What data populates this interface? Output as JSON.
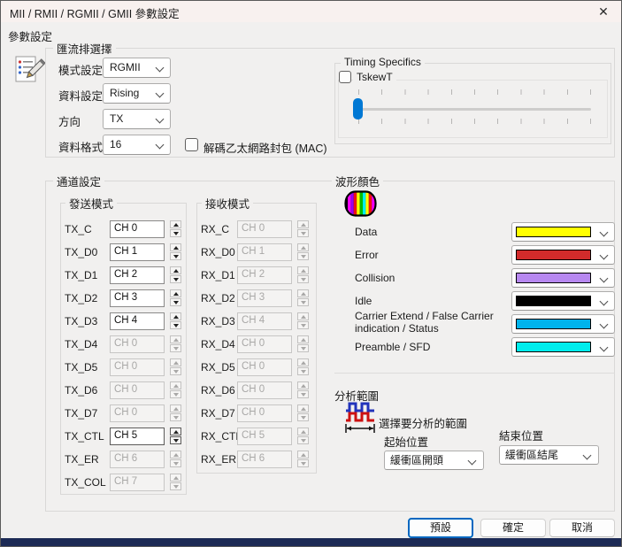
{
  "window": {
    "title": "MII / RMII / RGMII / GMII 參數設定",
    "close_glyph": "✕",
    "tab_label": "參數設定"
  },
  "theme": {
    "accent": "#0078D4",
    "default_button_border": "#0067C0",
    "bottom_strip": "#1C2A55"
  },
  "bus": {
    "group_label": "匯流排選擇",
    "mode": {
      "label": "模式設定",
      "value": "RGMII"
    },
    "data_edge": {
      "label": "資料設定",
      "value": "Rising"
    },
    "direction": {
      "label": "方向",
      "value": "TX"
    },
    "data_format": {
      "label": "資料格式",
      "value": "16"
    },
    "mac_checkbox_label": "解碼乙太網路封包 (MAC)",
    "mac_checked": false
  },
  "timing": {
    "group_label": "Timing Specifics",
    "tskew_label": "TskewT",
    "tskew_checked": false,
    "slider_ticks": 11,
    "slider_position": "min"
  },
  "channels": {
    "group_label": "通道設定",
    "tx": {
      "group_label": "發送模式",
      "rows": [
        {
          "label": "TX_C",
          "value": "CH 0",
          "enabled": true
        },
        {
          "label": "TX_D0",
          "value": "CH 1",
          "enabled": true
        },
        {
          "label": "TX_D1",
          "value": "CH 2",
          "enabled": true
        },
        {
          "label": "TX_D2",
          "value": "CH 3",
          "enabled": true
        },
        {
          "label": "TX_D3",
          "value": "CH 4",
          "enabled": true
        },
        {
          "label": "TX_D4",
          "value": "CH 0",
          "enabled": false
        },
        {
          "label": "TX_D5",
          "value": "CH 0",
          "enabled": false
        },
        {
          "label": "TX_D6",
          "value": "CH 0",
          "enabled": false
        },
        {
          "label": "TX_D7",
          "value": "CH 0",
          "enabled": false
        },
        {
          "label": "TX_CTL",
          "value": "CH 5",
          "enabled": true
        },
        {
          "label": "TX_ER",
          "value": "CH 6",
          "enabled": false
        },
        {
          "label": "TX_COL",
          "value": "CH 7",
          "enabled": false
        }
      ]
    },
    "rx": {
      "group_label": "接收模式",
      "rows": [
        {
          "label": "RX_C",
          "value": "CH 0",
          "enabled": false
        },
        {
          "label": "RX_D0",
          "value": "CH 1",
          "enabled": false
        },
        {
          "label": "RX_D1",
          "value": "CH 2",
          "enabled": false
        },
        {
          "label": "RX_D2",
          "value": "CH 3",
          "enabled": false
        },
        {
          "label": "RX_D3",
          "value": "CH 4",
          "enabled": false
        },
        {
          "label": "RX_D4",
          "value": "CH 0",
          "enabled": false
        },
        {
          "label": "RX_D5",
          "value": "CH 0",
          "enabled": false
        },
        {
          "label": "RX_D6",
          "value": "CH 0",
          "enabled": false
        },
        {
          "label": "RX_D7",
          "value": "CH 0",
          "enabled": false
        },
        {
          "label": "RX_CTL",
          "value": "CH 5",
          "enabled": false
        },
        {
          "label": "RX_ER",
          "value": "CH 6",
          "enabled": false
        }
      ]
    }
  },
  "colors": {
    "group_label": "波形顏色",
    "rows": [
      {
        "label": "Data",
        "color": "#FFFF00"
      },
      {
        "label": "Error",
        "color": "#D22B2B"
      },
      {
        "label": "Collision",
        "color": "#B788F0"
      },
      {
        "label": "Idle",
        "color": "#000000"
      },
      {
        "label": "Carrier Extend / False Carrier indication / Status",
        "color": "#00B3EC"
      },
      {
        "label": "Preamble / SFD",
        "color": "#00EDED"
      }
    ]
  },
  "analysis": {
    "group_label": "分析範圍",
    "hint": "選擇要分析的範圍",
    "start": {
      "label": "起始位置",
      "value": "緩衝區開頭"
    },
    "end": {
      "label": "結束位置",
      "value": "緩衝區結尾"
    }
  },
  "buttons": {
    "default": "預設",
    "ok": "確定",
    "cancel": "取消"
  }
}
